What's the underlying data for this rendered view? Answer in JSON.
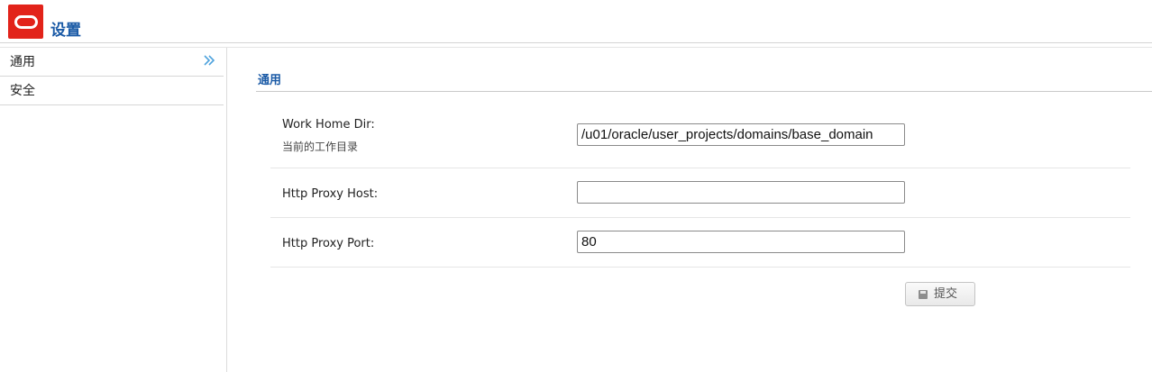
{
  "header": {
    "app_title": "设置",
    "logo_icon": "oracle-logo-icon",
    "brand_color": "#e2231a",
    "title_color": "#1a5aa6"
  },
  "sidebar": {
    "items": [
      {
        "label": "通用",
        "selected": true,
        "icon": "double-chevron-right-icon"
      },
      {
        "label": "安全",
        "selected": false
      }
    ]
  },
  "main": {
    "section_title": "通用",
    "fields": [
      {
        "label": "Work Home Dir:",
        "description": "当前的工作目录",
        "value": "/u01/oracle/user_projects/domains/base_domain"
      },
      {
        "label": "Http Proxy Host:",
        "value": ""
      },
      {
        "label": "Http Proxy Port:",
        "value": "80"
      }
    ],
    "submit": {
      "label": "提交",
      "icon": "save-disk-icon"
    }
  }
}
